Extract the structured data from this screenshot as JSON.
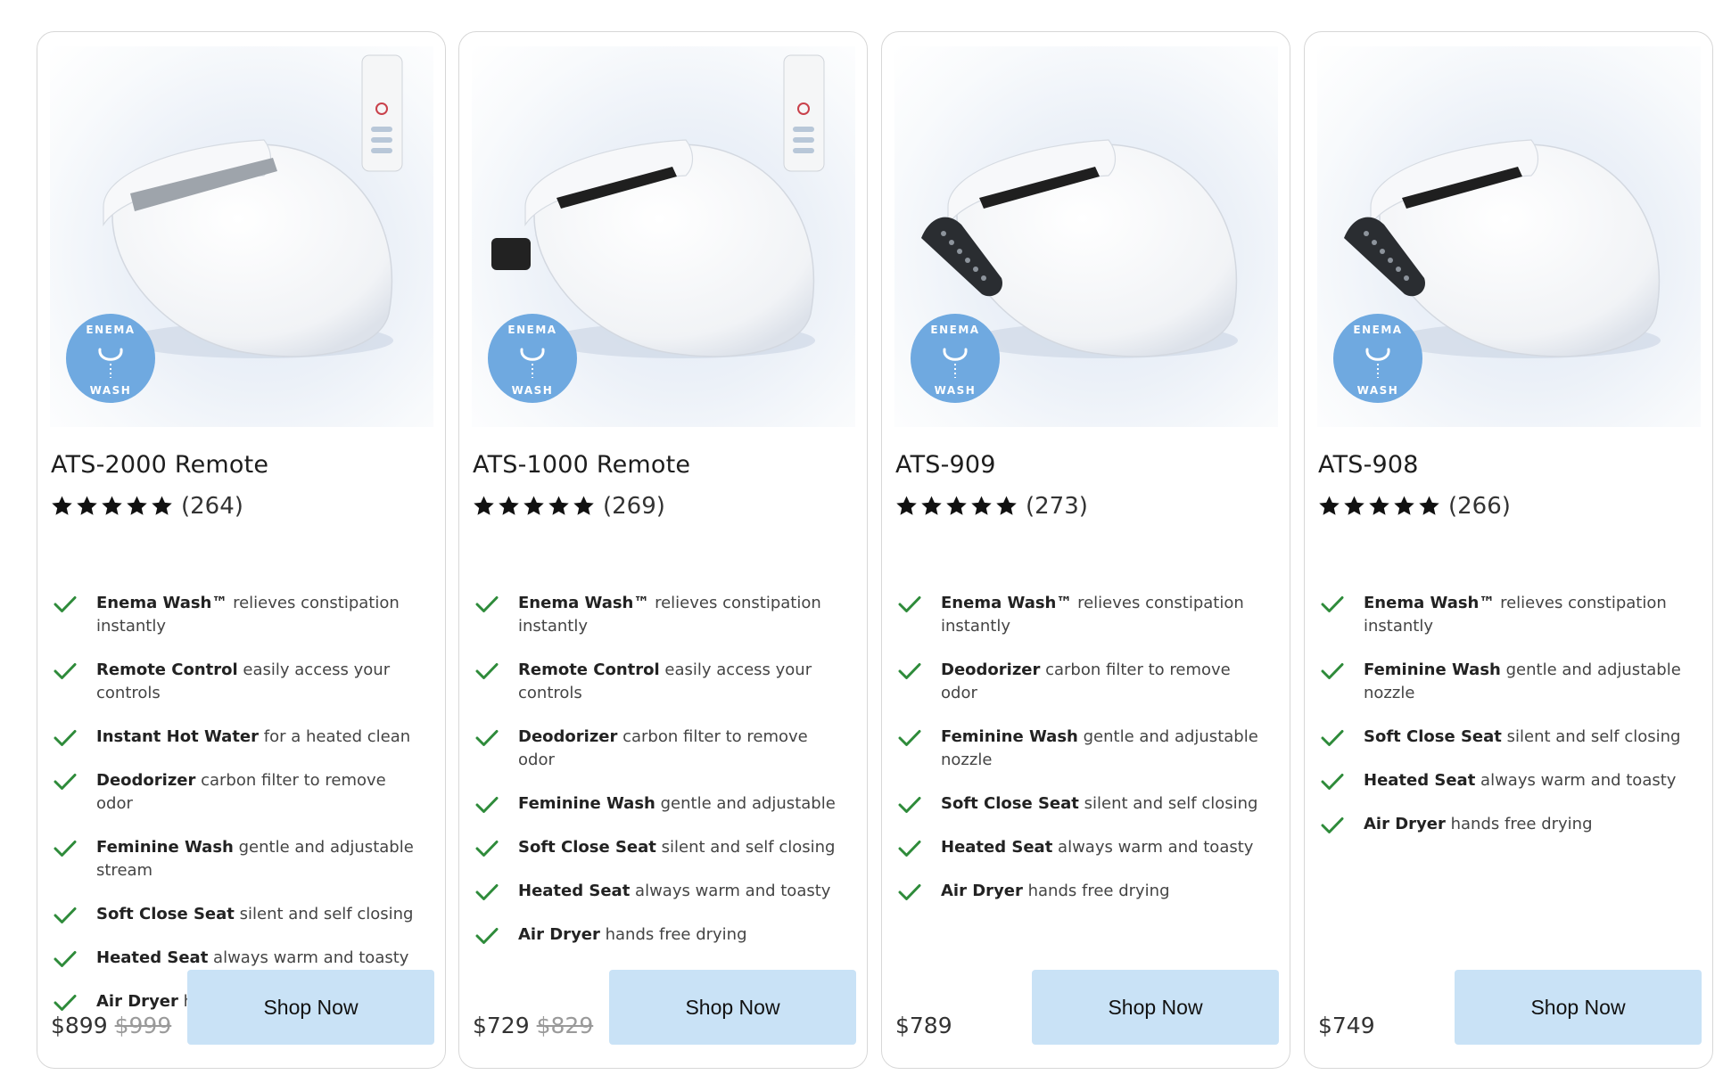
{
  "colors": {
    "check": "#2e8b3a",
    "button_bg": "#c9e2f6",
    "badge": "#6fa9e0",
    "star": "#111111"
  },
  "icons": {
    "check": "checkmark-icon",
    "star": "star-icon",
    "badge": "enema-wash-badge"
  },
  "products": [
    {
      "name": "ATS-2000 Remote",
      "stars": 5,
      "reviews": "(264)",
      "badge_top": "ENEMA",
      "badge_bottom": "WASH",
      "features": [
        {
          "bold": "Enema Wash™",
          "text": " relieves constipation instantly"
        },
        {
          "bold": "Remote Control",
          "text": " easily access your controls"
        },
        {
          "bold": "Instant Hot Water",
          "text": " for a heated clean"
        },
        {
          "bold": "Deodorizer",
          "text": " carbon filter to remove odor"
        },
        {
          "bold": "Feminine Wash",
          "text": " gentle and adjustable stream"
        },
        {
          "bold": "Soft Close Seat",
          "text": " silent and self closing"
        },
        {
          "bold": "Heated Seat",
          "text": " always warm and toasty"
        },
        {
          "bold": "Air Dryer",
          "text": " hands free drying"
        }
      ],
      "price": "$899",
      "old_price": "$999",
      "cta": "Shop Now"
    },
    {
      "name": "ATS-1000 Remote",
      "stars": 5,
      "reviews": "(269)",
      "badge_top": "ENEMA",
      "badge_bottom": "WASH",
      "features": [
        {
          "bold": "Enema Wash™",
          "text": " relieves constipation instantly"
        },
        {
          "bold": "Remote Control",
          "text": " easily access your controls"
        },
        {
          "bold": "Deodorizer",
          "text": " carbon filter to remove odor"
        },
        {
          "bold": "Feminine Wash",
          "text": " gentle and adjustable"
        },
        {
          "bold": "Soft Close Seat",
          "text": " silent and self closing"
        },
        {
          "bold": "Heated Seat",
          "text": " always warm and toasty"
        },
        {
          "bold": "Air Dryer",
          "text": " hands free drying"
        }
      ],
      "price": "$729",
      "old_price": "$829",
      "cta": "Shop Now"
    },
    {
      "name": "ATS-909",
      "stars": 5,
      "reviews": "(273)",
      "badge_top": "ENEMA",
      "badge_bottom": "WASH",
      "features": [
        {
          "bold": "Enema Wash™",
          "text": " relieves constipation instantly"
        },
        {
          "bold": "Deodorizer",
          "text": " carbon filter to remove odor"
        },
        {
          "bold": "Feminine Wash",
          "text": " gentle and adjustable nozzle"
        },
        {
          "bold": "Soft Close Seat",
          "text": " silent and self closing"
        },
        {
          "bold": "Heated Seat",
          "text": " always warm and toasty"
        },
        {
          "bold": "Air Dryer",
          "text": " hands free drying"
        }
      ],
      "price": "$789",
      "old_price": "",
      "cta": "Shop Now"
    },
    {
      "name": "ATS-908",
      "stars": 5,
      "reviews": "(266)",
      "badge_top": "ENEMA",
      "badge_bottom": "WASH",
      "features": [
        {
          "bold": "Enema Wash™",
          "text": " relieves constipation instantly"
        },
        {
          "bold": "Feminine Wash",
          "text": " gentle and adjustable nozzle"
        },
        {
          "bold": "Soft Close Seat",
          "text": " silent and self closing"
        },
        {
          "bold": "Heated Seat",
          "text": " always warm and toasty"
        },
        {
          "bold": "Air Dryer",
          "text": " hands free drying"
        }
      ],
      "price": "$749",
      "old_price": "",
      "cta": "Shop Now"
    }
  ]
}
